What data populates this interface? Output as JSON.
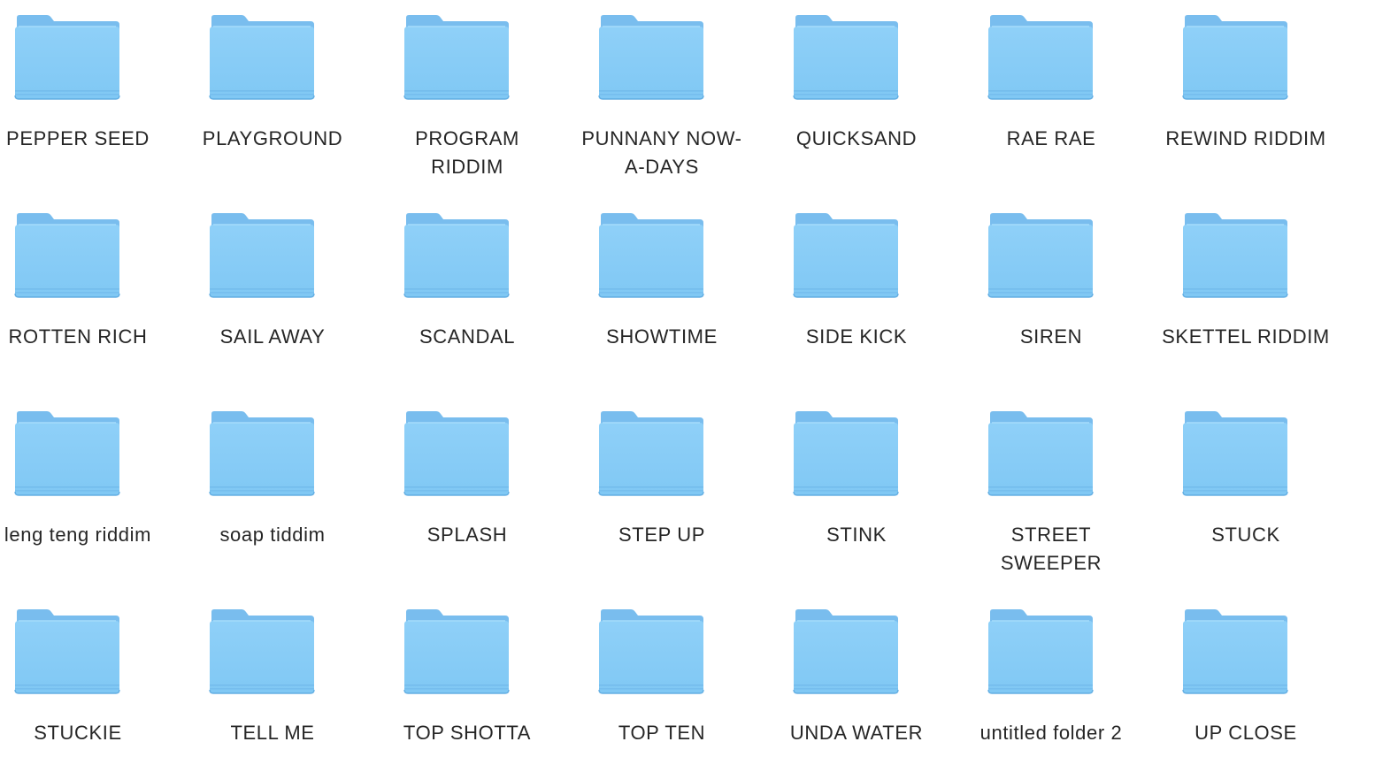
{
  "window": {
    "view": "icon-grid"
  },
  "icon": {
    "name": "folder-icon",
    "colors": {
      "tab": "#7cc2f0",
      "back": "#79bdee",
      "front_top": "#8fd0f8",
      "front_bottom": "#80c8f4",
      "edge": "#5aa8e0",
      "stripe": "#6fb7ea"
    }
  },
  "folders": [
    {
      "label": "PEPPER SEED"
    },
    {
      "label": "PLAYGROUND"
    },
    {
      "label": "PROGRAM RIDDIM"
    },
    {
      "label": "PUNNANY NOW-A-DAYS"
    },
    {
      "label": "QUICKSAND"
    },
    {
      "label": "RAE RAE"
    },
    {
      "label": "REWIND RIDDIM"
    },
    {
      "label": "ROTTEN RICH"
    },
    {
      "label": "SAIL AWAY"
    },
    {
      "label": "SCANDAL"
    },
    {
      "label": "SHOWTIME"
    },
    {
      "label": "SIDE KICK"
    },
    {
      "label": "SIREN"
    },
    {
      "label": "SKETTEL RIDDIM"
    },
    {
      "label": "leng teng riddim"
    },
    {
      "label": "soap tiddim"
    },
    {
      "label": "SPLASH"
    },
    {
      "label": "STEP UP"
    },
    {
      "label": "STINK"
    },
    {
      "label": "STREET SWEEPER"
    },
    {
      "label": "STUCK"
    },
    {
      "label": "STUCKIE"
    },
    {
      "label": "TELL ME"
    },
    {
      "label": "TOP SHOTTA"
    },
    {
      "label": "TOP TEN"
    },
    {
      "label": "UNDA WATER"
    },
    {
      "label": "untitled folder 2"
    },
    {
      "label": "UP CLOSE"
    }
  ]
}
